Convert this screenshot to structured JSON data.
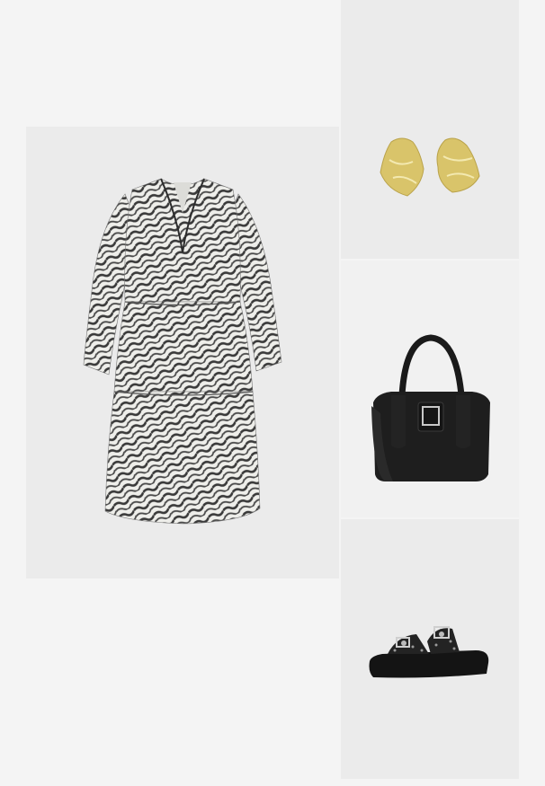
{
  "outfit": {
    "items": [
      {
        "id": "dress",
        "icon": "zebra-print-dress-image",
        "panel_color": "#ebebeb"
      },
      {
        "id": "earrings",
        "icon": "gold-earrings-image",
        "panel_color": "#ebebeb"
      },
      {
        "id": "bag",
        "icon": "black-handbag-image",
        "panel_color": "#f1f1f1"
      },
      {
        "id": "sandals",
        "icon": "black-studded-sandals-image",
        "panel_color": "#ebebeb"
      }
    ],
    "colors": {
      "page_background": "#f4f4f4",
      "gold": "#d9c46a",
      "black": "#1a1a1a",
      "print_dark": "#3a3a3a",
      "print_light": "#eeeeea"
    }
  }
}
